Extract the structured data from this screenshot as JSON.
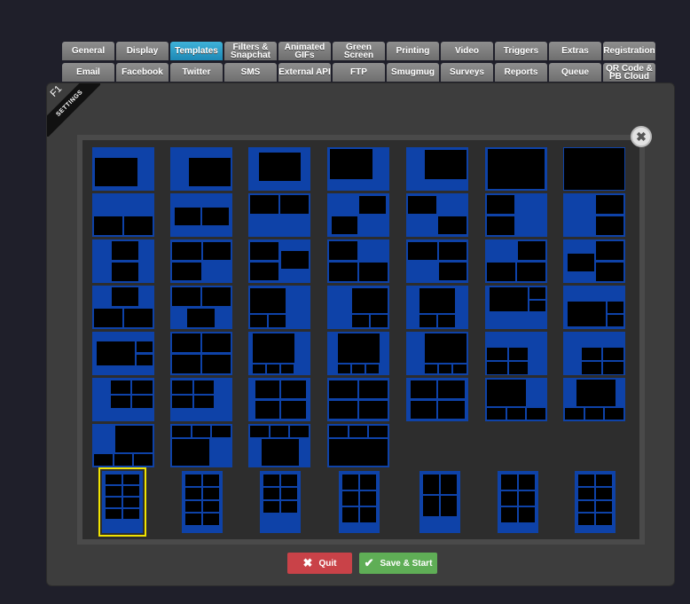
{
  "tabs": {
    "row1": [
      "General",
      "Display",
      "Templates",
      "Filters & Snapchat",
      "Animated GIFs",
      "Green Screen",
      "Printing",
      "Video",
      "Triggers",
      "Extras",
      "Registration"
    ],
    "row2": [
      "Email",
      "Facebook",
      "Twitter",
      "SMS",
      "External API",
      "FTP",
      "Smugmug",
      "Surveys",
      "Reports",
      "Queue",
      "QR Code & PB Cloud"
    ],
    "active": "Templates"
  },
  "ribbon": {
    "f1": "F1",
    "label": "SETTINGS"
  },
  "close_icon": "close-icon",
  "buttons": {
    "quit": "Quit",
    "save": "Save & Start"
  },
  "colors": {
    "template_bg": "#0e42a8",
    "selected": "#f0e300",
    "quit": "#c94248",
    "save": "#5fae56"
  }
}
